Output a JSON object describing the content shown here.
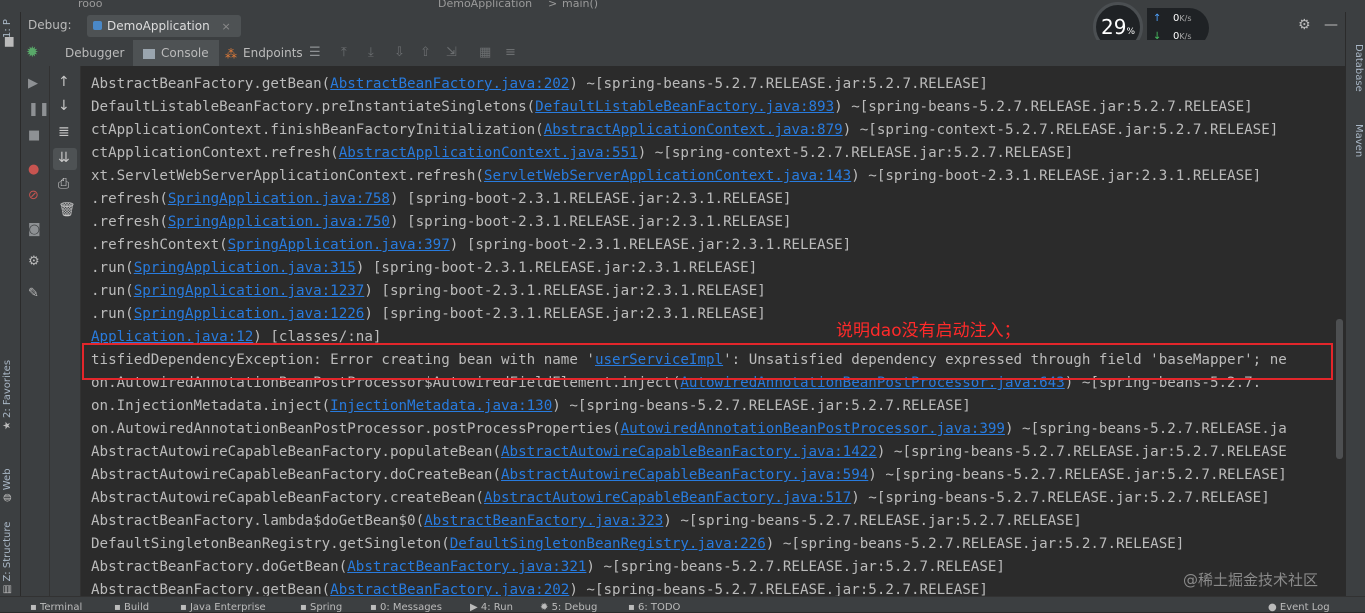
{
  "editor": {
    "tab_label": "rooo",
    "breadcrumb_class": "DemoApplication",
    "breadcrumb_sep": ">",
    "breadcrumb_method": "main()"
  },
  "left_stripe": {
    "project": "1: P",
    "favorites": "2: Favorites",
    "web": "Web",
    "structure": "Z: Structure"
  },
  "right_stripe": {
    "database": "Database",
    "maven": "Maven"
  },
  "debug": {
    "label": "Debug:",
    "tab": "DemoApplication",
    "close": "×"
  },
  "network": {
    "cpu_value": "29",
    "cpu_unit": "%",
    "up_value": "0",
    "down_value": "0",
    "unit": "K/s",
    "up_arrow": "↑",
    "down_arrow": "↓"
  },
  "toolbar": {
    "debugger": "Debugger",
    "console": "Console",
    "endpoints": "Endpoints"
  },
  "annotation": "说明dao没有启动注入；",
  "watermark": "@稀土掘金技术社区",
  "console_lines": [
    [
      {
        "t": "AbstractBeanFactory.getBean("
      },
      {
        "t": "AbstractBeanFactory.java:202",
        "l": true
      },
      {
        "t": ") ~[spring-beans-5.2.7.RELEASE.jar:5.2.7.RELEASE]"
      }
    ],
    [
      {
        "t": "DefaultListableBeanFactory.preInstantiateSingletons("
      },
      {
        "t": "DefaultListableBeanFactory.java:893",
        "l": true
      },
      {
        "t": ") ~[spring-beans-5.2.7.RELEASE.jar:5.2.7.RELEASE]"
      }
    ],
    [
      {
        "t": "ctApplicationContext.finishBeanFactoryInitialization("
      },
      {
        "t": "AbstractApplicationContext.java:879",
        "l": true
      },
      {
        "t": ") ~[spring-context-5.2.7.RELEASE.jar:5.2.7.RELEASE]"
      }
    ],
    [
      {
        "t": "ctApplicationContext.refresh("
      },
      {
        "t": "AbstractApplicationContext.java:551",
        "l": true
      },
      {
        "t": ") ~[spring-context-5.2.7.RELEASE.jar:5.2.7.RELEASE]"
      }
    ],
    [
      {
        "t": "xt.ServletWebServerApplicationContext.refresh("
      },
      {
        "t": "ServletWebServerApplicationContext.java:143",
        "l": true
      },
      {
        "t": ") ~[spring-boot-2.3.1.RELEASE.jar:2.3.1.RELEASE]"
      }
    ],
    [
      {
        "t": ".refresh("
      },
      {
        "t": "SpringApplication.java:758",
        "l": true
      },
      {
        "t": ") [spring-boot-2.3.1.RELEASE.jar:2.3.1.RELEASE]"
      }
    ],
    [
      {
        "t": ".refresh("
      },
      {
        "t": "SpringApplication.java:750",
        "l": true
      },
      {
        "t": ") [spring-boot-2.3.1.RELEASE.jar:2.3.1.RELEASE]"
      }
    ],
    [
      {
        "t": ".refreshContext("
      },
      {
        "t": "SpringApplication.java:397",
        "l": true
      },
      {
        "t": ") [spring-boot-2.3.1.RELEASE.jar:2.3.1.RELEASE]"
      }
    ],
    [
      {
        "t": ".run("
      },
      {
        "t": "SpringApplication.java:315",
        "l": true
      },
      {
        "t": ") [spring-boot-2.3.1.RELEASE.jar:2.3.1.RELEASE]"
      }
    ],
    [
      {
        "t": ".run("
      },
      {
        "t": "SpringApplication.java:1237",
        "l": true
      },
      {
        "t": ") [spring-boot-2.3.1.RELEASE.jar:2.3.1.RELEASE]"
      }
    ],
    [
      {
        "t": ".run("
      },
      {
        "t": "SpringApplication.java:1226",
        "l": true
      },
      {
        "t": ") [spring-boot-2.3.1.RELEASE.jar:2.3.1.RELEASE]"
      }
    ],
    [
      {
        "t": "Application.java:12",
        "l": true
      },
      {
        "t": ") [classes/:na]"
      }
    ],
    [
      {
        "t": "tisfiedDependencyException: Error creating bean with name '"
      },
      {
        "t": "userServiceImpl",
        "l": true
      },
      {
        "t": "': Unsatisfied dependency expressed through field 'baseMapper'; ne"
      }
    ],
    [
      {
        "t": "on.AutowiredAnnotationBeanPostProcessor$AutowiredFieldElement.inject("
      },
      {
        "t": "AutowiredAnnotationBeanPostProcessor.java:643",
        "l": true
      },
      {
        "t": ") ~[spring-beans-5.2.7."
      }
    ],
    [
      {
        "t": "on.InjectionMetadata.inject("
      },
      {
        "t": "InjectionMetadata.java:130",
        "l": true
      },
      {
        "t": ") ~[spring-beans-5.2.7.RELEASE.jar:5.2.7.RELEASE]"
      }
    ],
    [
      {
        "t": "on.AutowiredAnnotationBeanPostProcessor.postProcessProperties("
      },
      {
        "t": "AutowiredAnnotationBeanPostProcessor.java:399",
        "l": true
      },
      {
        "t": ") ~[spring-beans-5.2.7.RELEASE.ja"
      }
    ],
    [
      {
        "t": "AbstractAutowireCapableBeanFactory.populateBean("
      },
      {
        "t": "AbstractAutowireCapableBeanFactory.java:1422",
        "l": true
      },
      {
        "t": ") ~[spring-beans-5.2.7.RELEASE.jar:5.2.7.RELEASE"
      }
    ],
    [
      {
        "t": "AbstractAutowireCapableBeanFactory.doCreateBean("
      },
      {
        "t": "AbstractAutowireCapableBeanFactory.java:594",
        "l": true
      },
      {
        "t": ") ~[spring-beans-5.2.7.RELEASE.jar:5.2.7.RELEASE]"
      }
    ],
    [
      {
        "t": "AbstractAutowireCapableBeanFactory.createBean("
      },
      {
        "t": "AbstractAutowireCapableBeanFactory.java:517",
        "l": true
      },
      {
        "t": ") ~[spring-beans-5.2.7.RELEASE.jar:5.2.7.RELEASE]"
      }
    ],
    [
      {
        "t": "AbstractBeanFactory.lambda$doGetBean$0("
      },
      {
        "t": "AbstractBeanFactory.java:323",
        "l": true
      },
      {
        "t": ") ~[spring-beans-5.2.7.RELEASE.jar:5.2.7.RELEASE]"
      }
    ],
    [
      {
        "t": "DefaultSingletonBeanRegistry.getSingleton("
      },
      {
        "t": "DefaultSingletonBeanRegistry.java:226",
        "l": true
      },
      {
        "t": ") ~[spring-beans-5.2.7.RELEASE.jar:5.2.7.RELEASE]"
      }
    ],
    [
      {
        "t": "AbstractBeanFactory.doGetBean("
      },
      {
        "t": "AbstractBeanFactory.java:321",
        "l": true
      },
      {
        "t": ") ~[spring-beans-5.2.7.RELEASE.jar:5.2.7.RELEASE]"
      }
    ],
    [
      {
        "t": "AbstractBeanFactory.getBean("
      },
      {
        "t": "AbstractBeanFactory.java:202",
        "l": true
      },
      {
        "t": ") ~[spring-beans-5.2.7.RELEASE.jar:5.2.7.RELEASE]"
      }
    ]
  ],
  "bottom_tabs": {
    "terminal": "Terminal",
    "build": "Build",
    "java_enterprise": "Java Enterprise",
    "spring": "Spring",
    "messages": "0: Messages",
    "run": "4: Run",
    "debug": "5: Debug",
    "todo": "6: TODO",
    "event_log": "Event Log"
  }
}
